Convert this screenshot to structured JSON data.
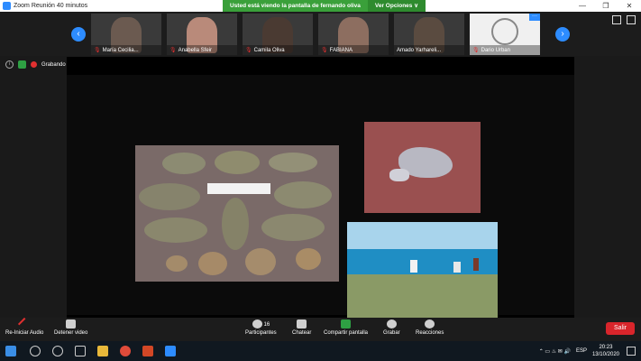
{
  "window": {
    "title": "Zoom Reunión 40 minutos",
    "controls": [
      "—",
      "❐",
      "✕"
    ]
  },
  "banner": {
    "message": "Usted está viendo la pantalla de fernando oliva",
    "options_label": "Ver Opciones ∨"
  },
  "participants": [
    {
      "name": "María Cecilia...",
      "skin": "#6b5a50"
    },
    {
      "name": "Anabella Sfeir",
      "skin": "#b98a7a"
    },
    {
      "name": "Camila Oliva",
      "skin": "#4a3a32"
    },
    {
      "name": "FABIANA",
      "skin": "#8d6e60"
    },
    {
      "name": "Amado Yarhareli...",
      "skin": "#5a4b40"
    },
    {
      "name": "Dario Urban",
      "skin": "#e8e8e8"
    }
  ],
  "recording": {
    "label": "Grabando"
  },
  "toolbar": {
    "audio_label": "Re-Iniciar Audio",
    "video_label": "Detener video",
    "participants_label": "Participantes",
    "participants_count": "16",
    "chat_label": "Chatear",
    "share_label": "Compartir pantalla",
    "record_label": "Grabar",
    "reactions_label": "Reacciones",
    "leave_label": "Salir"
  },
  "taskbar": {
    "lang": "ESP",
    "time": "20:23",
    "date": "13/10/2020"
  },
  "colors": {
    "accent": "#2d8cff",
    "share_green": "#3aa03a",
    "leave_red": "#d9252b"
  }
}
